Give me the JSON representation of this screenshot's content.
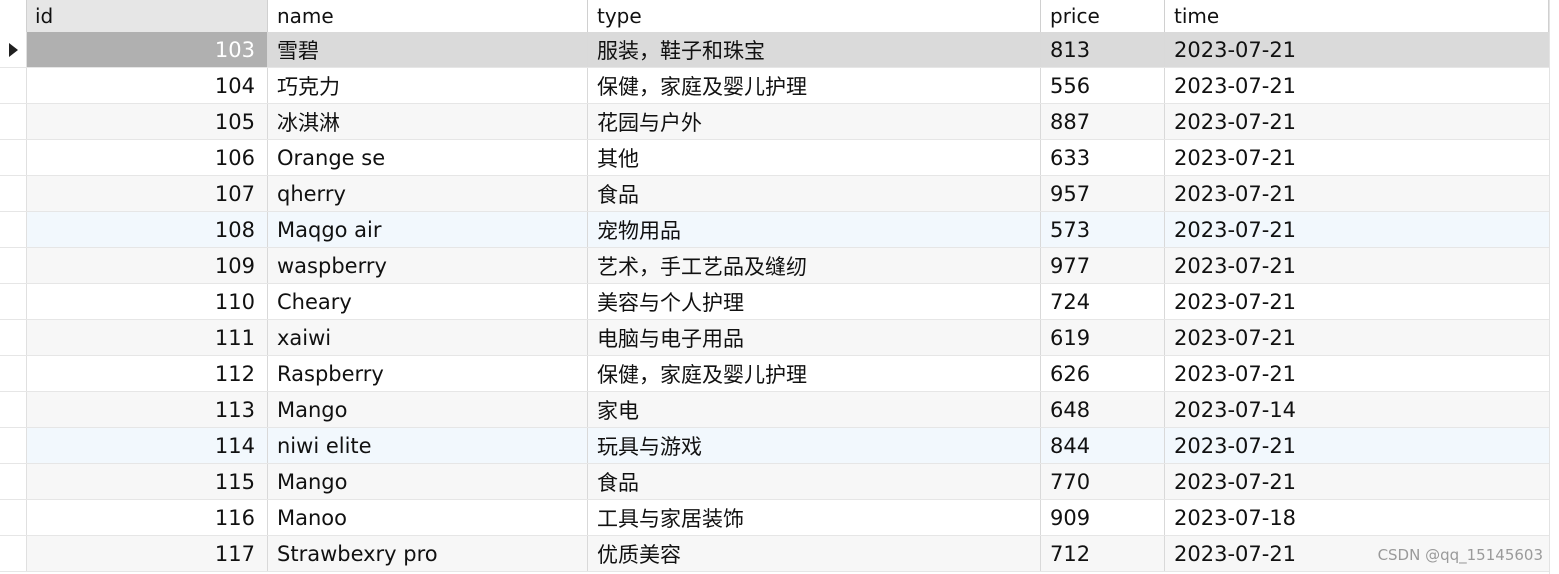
{
  "table": {
    "columns": [
      "id",
      "name",
      "type",
      "price",
      "time"
    ],
    "selected_row_index": 0,
    "rows": [
      {
        "id": "103",
        "name": "雪碧",
        "type": "服装，鞋子和珠宝",
        "price": "813",
        "time": "2023-07-21"
      },
      {
        "id": "104",
        "name": "巧克力",
        "type": "保健，家庭及婴儿护理",
        "price": "556",
        "time": "2023-07-21"
      },
      {
        "id": "105",
        "name": "冰淇淋",
        "type": "花园与户外",
        "price": "887",
        "time": "2023-07-21"
      },
      {
        "id": "106",
        "name": "Orange se",
        "type": "其他",
        "price": "633",
        "time": "2023-07-21"
      },
      {
        "id": "107",
        "name": "qherry",
        "type": "食品",
        "price": "957",
        "time": "2023-07-21"
      },
      {
        "id": "108",
        "name": "Maqgo air",
        "type": "宠物用品",
        "price": "573",
        "time": "2023-07-21"
      },
      {
        "id": "109",
        "name": "waspberry",
        "type": "艺术，手工艺品及缝纫",
        "price": "977",
        "time": "2023-07-21"
      },
      {
        "id": "110",
        "name": "Cheary",
        "type": "美容与个人护理",
        "price": "724",
        "time": "2023-07-21"
      },
      {
        "id": "111",
        "name": "xaiwi",
        "type": "电脑与电子用品",
        "price": "619",
        "time": "2023-07-21"
      },
      {
        "id": "112",
        "name": "Raspberry",
        "type": "保健，家庭及婴儿护理",
        "price": "626",
        "time": "2023-07-21"
      },
      {
        "id": "113",
        "name": "Mango",
        "type": "家电",
        "price": "648",
        "time": "2023-07-14"
      },
      {
        "id": "114",
        "name": "niwi elite",
        "type": "玩具与游戏",
        "price": "844",
        "time": "2023-07-21"
      },
      {
        "id": "115",
        "name": "Mango",
        "type": "食品",
        "price": "770",
        "time": "2023-07-21"
      },
      {
        "id": "116",
        "name": "Manoo",
        "type": "工具与家居装饰",
        "price": "909",
        "time": "2023-07-18"
      },
      {
        "id": "117",
        "name": "Strawbexry pro",
        "type": "优质美容",
        "price": "712",
        "time": "2023-07-21"
      }
    ]
  },
  "watermark": "CSDN @qq_15145603",
  "colors": {
    "selected_row": "#dadada",
    "selected_id_cell": "#b0b0b0",
    "alt_row": "#f7f7f7",
    "highlight_row": "#f2f8fd"
  }
}
